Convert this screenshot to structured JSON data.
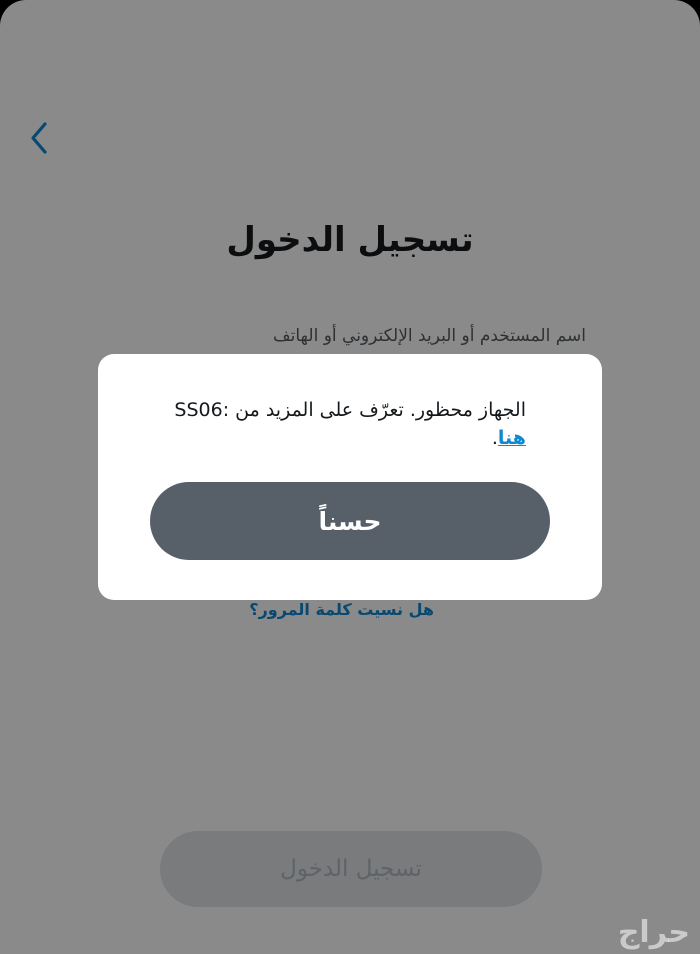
{
  "screen": {
    "title": "تسجيل الدخول",
    "username_label": "اسم المستخدم أو البريد الإلكتروني أو الهاتف",
    "forgot_password": "هل نسيت كلمة المرور؟",
    "login_button": "تسجيل الدخول"
  },
  "dialog": {
    "message_prefix": "الجهاز محظور. تعرّف على المزيد من",
    "message_link": "هنا",
    "message_suffix": ".",
    "code": "SS06:",
    "ok_button": "حسناً"
  },
  "watermark": "حراج",
  "icons": {
    "back": "chevron-left-icon"
  },
  "colors": {
    "accent": "#0f88d1",
    "dialog_button": "#575f69",
    "overlay": "rgba(0,0,0,0.46)"
  }
}
